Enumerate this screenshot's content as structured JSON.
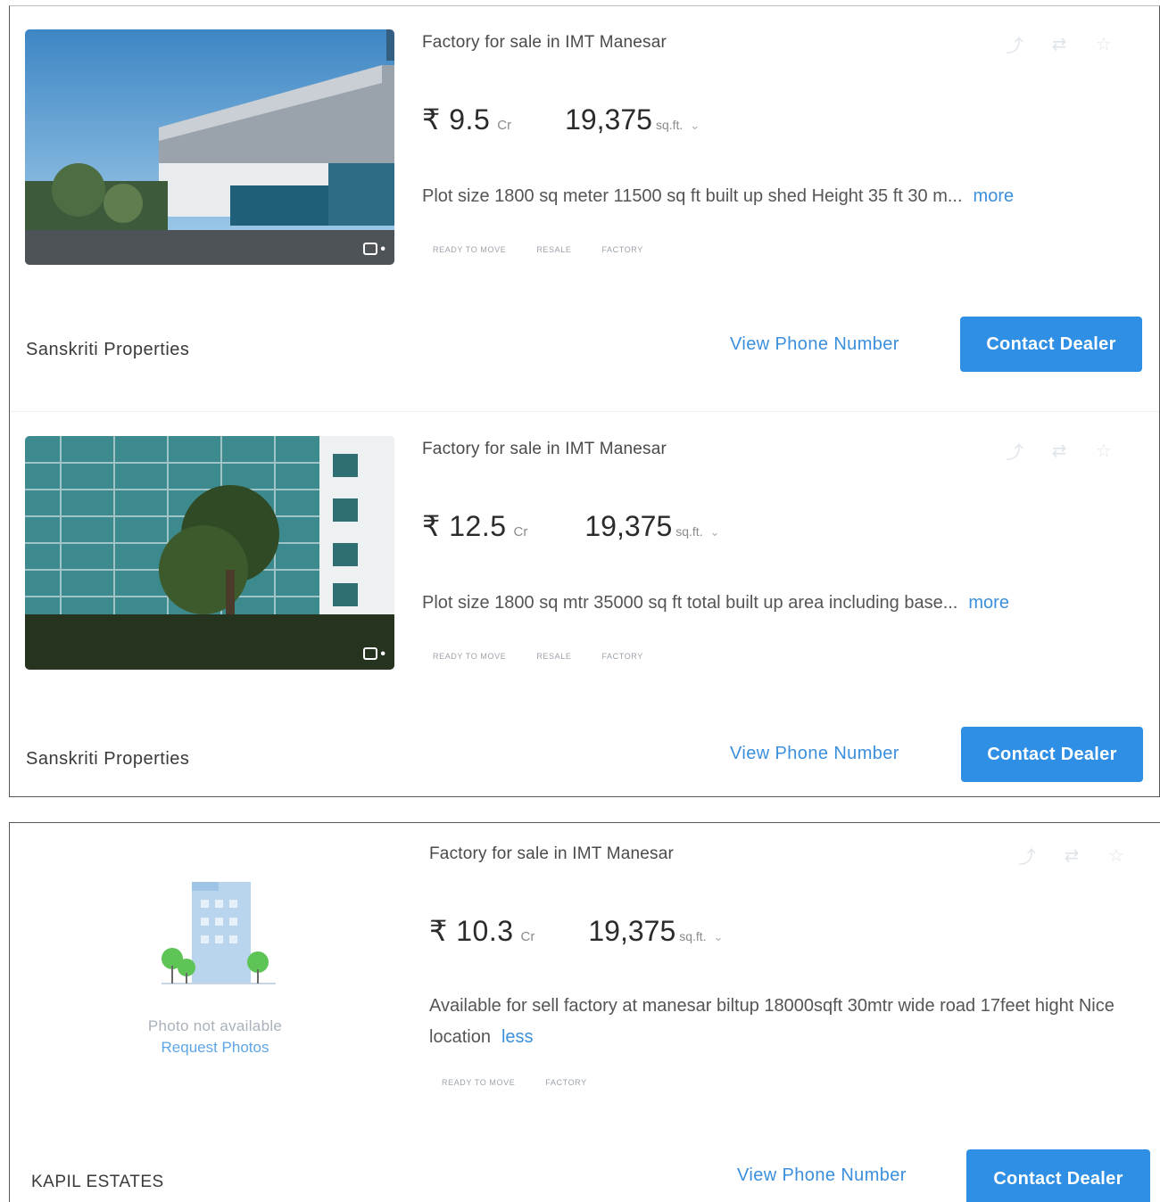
{
  "listings": [
    {
      "title": "Factory for sale in IMT Manesar",
      "price": "₹ 9.5",
      "price_unit": "Cr",
      "area": "19,375",
      "area_unit": "sq.ft.",
      "description": "Plot size 1800 sq meter 11500 sq ft built up shed Height 35 ft 30 m...",
      "toggle_label": "more",
      "tags": [
        "Ready to move",
        "Resale",
        "Factory"
      ],
      "dealer": "Sanskriti Properties",
      "view_phone_label": "View Phone Number",
      "contact_label": "Contact Dealer"
    },
    {
      "title": "Factory for sale in IMT Manesar",
      "price": "₹ 12.5",
      "price_unit": "Cr",
      "area": "19,375",
      "area_unit": "sq.ft.",
      "description": "Plot size 1800 sq mtr 35000 sq ft total built up area including base...",
      "toggle_label": "more",
      "tags": [
        "Ready to move",
        "Resale",
        "Factory"
      ],
      "dealer": "Sanskriti Properties",
      "view_phone_label": "View Phone Number",
      "contact_label": "Contact Dealer"
    },
    {
      "title": "Factory for sale in IMT Manesar",
      "price": "₹ 10.3",
      "price_unit": "Cr",
      "area": "19,375",
      "area_unit": "sq.ft.",
      "description": "Available for sell factory at manesar biltup 18000sqft 30mtr wide road 17feet hight Nice location",
      "toggle_label": "less",
      "tags": [
        "Ready to move",
        "Factory"
      ],
      "no_photo_text": "Photo not available",
      "request_photos_label": "Request Photos",
      "dealer": "KAPIL ESTATES",
      "view_phone_label": "View Phone Number",
      "contact_label": "Contact Dealer"
    }
  ],
  "icons": [
    "share-icon",
    "shortlist-icon",
    "star-icon",
    "camera-icon",
    "building-placeholder-icon"
  ],
  "colors": {
    "accent": "#2f8fe4",
    "link": "#3b8fdc",
    "muted": "#d2d7dd"
  }
}
